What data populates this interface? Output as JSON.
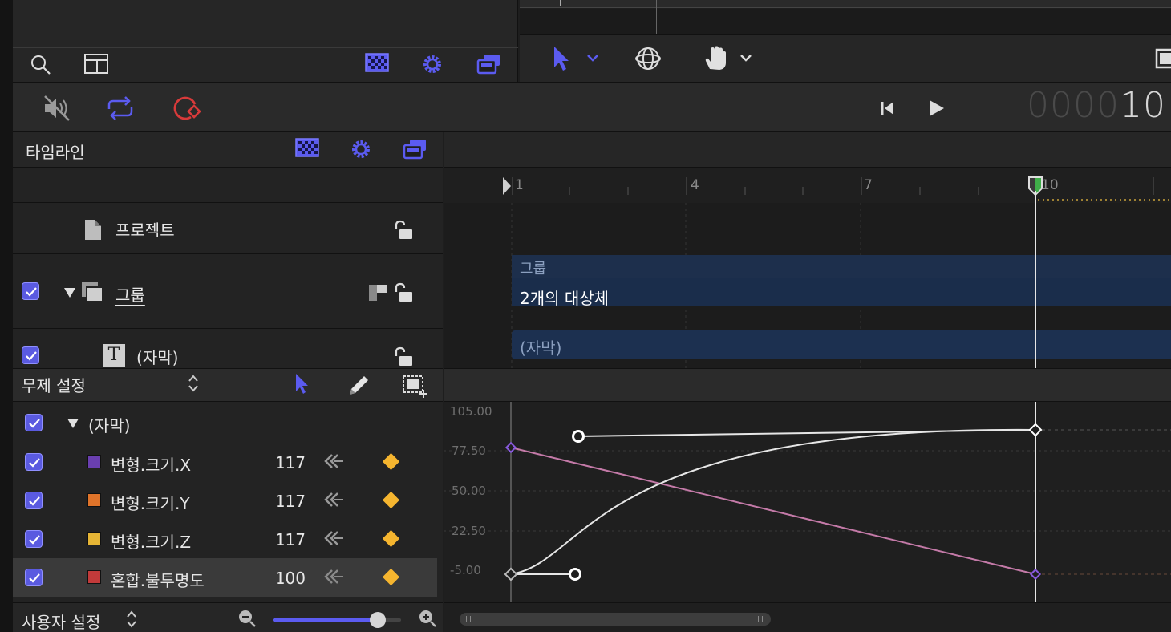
{
  "colors": {
    "accent": "#5b5bf0",
    "record": "#d83a3a",
    "playhead_marker": "#3fae49",
    "keyframe": "#f5b52f",
    "curve_pink": "#c47aa8"
  },
  "toolbar": {
    "icons": [
      "search-icon",
      "layout-icon",
      "checkerboard-icon",
      "gear-icon",
      "layers-icon",
      "select-arrow-icon",
      "orbit-icon",
      "hand-icon"
    ]
  },
  "transport": {
    "timecode_dim": "0000",
    "timecode_bright": "10"
  },
  "timeline": {
    "title": "타임라인",
    "ruler_ticks": [
      "1",
      "4",
      "7",
      "10"
    ],
    "layers": [
      {
        "name": "프로젝트"
      },
      {
        "name": "그룹"
      },
      {
        "name": "(자막)"
      }
    ],
    "clips": {
      "group_label": "그룹",
      "group_summary": "2개의 대상체",
      "caption_clip": "(자막)"
    }
  },
  "keyframe_editor": {
    "menu_label": "무제 설정",
    "parent": "(자막)",
    "params": [
      {
        "name": "변형.크기.X",
        "value": "117",
        "color": "#6a3fb0"
      },
      {
        "name": "변형.크기.Y",
        "value": "117",
        "color": "#e0742a"
      },
      {
        "name": "변형.크기.Z",
        "value": "117",
        "color": "#e6b535"
      },
      {
        "name": "혼합.불투명도",
        "value": "100",
        "color": "#c23a3a"
      }
    ],
    "y_axis_labels": [
      "105.00",
      "77.50",
      "50.00",
      "22.50",
      "-5.00"
    ],
    "footer_menu": "사용자 설정",
    "zoom_level": 0.82
  }
}
